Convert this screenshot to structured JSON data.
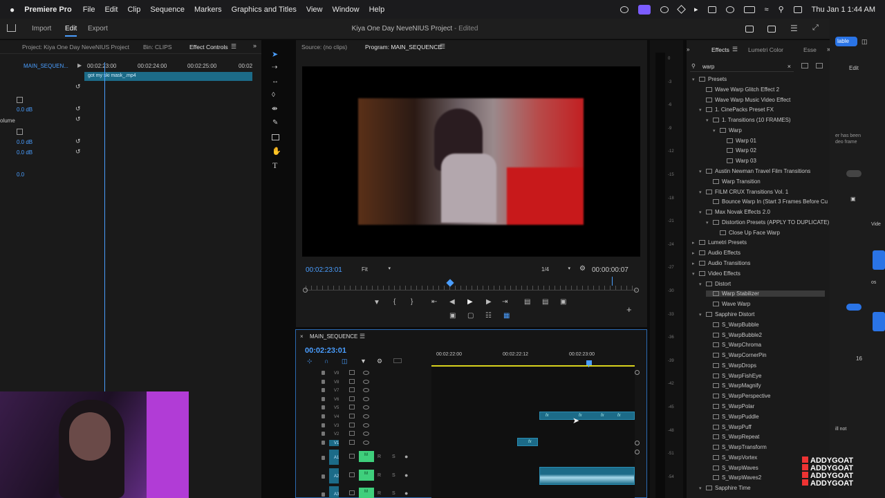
{
  "menubar": {
    "app": "Premiere Pro",
    "items": [
      "File",
      "Edit",
      "Clip",
      "Sequence",
      "Markers",
      "Graphics and Titles",
      "View",
      "Window",
      "Help"
    ],
    "clock": "Thu Jan 1  1:44 AM"
  },
  "header": {
    "import": "Import",
    "edit": "Edit",
    "export": "Export",
    "title": "Kiya One Day NeveNIUS Project",
    "status": "- Edited"
  },
  "left": {
    "tabs": [
      "Project: Kiya One Day NeveNIUS Project",
      "Bin: CLIPS",
      "Effect Controls"
    ],
    "seq_label": "MAIN_SEQUEN...",
    "timecodes": [
      "00:02:23:00",
      "00:02:24:00",
      "00:02:25:00",
      "00:02"
    ],
    "clip_name": "got my ski mask_.mp4",
    "values": [
      "0.0 dB",
      "0.0 dB",
      "0.0 dB",
      "0.0"
    ],
    "volume_label": "olume"
  },
  "source": {
    "source_tab": "Source: (no clips)",
    "program_tab": "Program: MAIN_SEQUENCE",
    "timecode": "00:02:23:01",
    "fit": "Fit",
    "ratio": "1/4",
    "duration": "00:00:00:07"
  },
  "timeline": {
    "title": "MAIN_SEQUENCE",
    "timecode": "00:02:23:01",
    "ruler": [
      "00:02:22:00",
      "00:02:22:12",
      "00:02:23:00"
    ],
    "video_tracks": [
      "V9",
      "V8",
      "V7",
      "V6",
      "V5",
      "V4",
      "V3",
      "V2",
      "V1"
    ],
    "audio_tracks": [
      "A1",
      "A2",
      "A3"
    ],
    "audio_buttons": {
      "m": "M",
      "r": "R",
      "s": "S"
    },
    "fx": "fx"
  },
  "meter": {
    "labels": [
      "0",
      "-3",
      "-6",
      "-9",
      "-12",
      "-15",
      "-18",
      "-21",
      "-24",
      "-27",
      "-30",
      "-33",
      "-36",
      "-39",
      "-42",
      "-45",
      "-48",
      "-51",
      "-54"
    ]
  },
  "effects": {
    "tabs": [
      "Effects",
      "Lumetri Color",
      "Esse"
    ],
    "search": "warp",
    "tree": [
      {
        "label": "Presets",
        "indent": 0,
        "type": "folder",
        "open": true
      },
      {
        "label": "Wave Warp Glitch Effect 2",
        "indent": 1,
        "type": "preset"
      },
      {
        "label": "Wave Warp Music Video Effect",
        "indent": 1,
        "type": "preset"
      },
      {
        "label": "1. CinePacks Preset FX",
        "indent": 1,
        "type": "folder",
        "open": true
      },
      {
        "label": "1. Transitions (10 FRAMES)",
        "indent": 2,
        "type": "folder",
        "open": true
      },
      {
        "label": "Warp",
        "indent": 3,
        "type": "folder",
        "open": true
      },
      {
        "label": "Warp 01",
        "indent": 4,
        "type": "preset"
      },
      {
        "label": "Warp 02",
        "indent": 4,
        "type": "preset"
      },
      {
        "label": "Warp 03",
        "indent": 4,
        "type": "preset"
      },
      {
        "label": "Austin Newman Travel Film Transitions",
        "indent": 1,
        "type": "folder",
        "open": true
      },
      {
        "label": "Warp Transition",
        "indent": 2,
        "type": "preset"
      },
      {
        "label": "FILM CRUX Transitions Vol. 1",
        "indent": 1,
        "type": "folder",
        "open": true
      },
      {
        "label": "Bounce Warp In (Start 3 Frames Before Cu",
        "indent": 2,
        "type": "preset"
      },
      {
        "label": "Max Novak Effects 2.0",
        "indent": 1,
        "type": "folder",
        "open": true
      },
      {
        "label": "Distortion Presets (APPLY TO DUPLICATE)",
        "indent": 2,
        "type": "folder",
        "open": true
      },
      {
        "label": "Close Up Face Warp",
        "indent": 3,
        "type": "preset"
      },
      {
        "label": "Lumetri Presets",
        "indent": 0,
        "type": "folder",
        "open": false
      },
      {
        "label": "Audio Effects",
        "indent": 0,
        "type": "folder",
        "open": false
      },
      {
        "label": "Audio Transitions",
        "indent": 0,
        "type": "folder",
        "open": false
      },
      {
        "label": "Video Effects",
        "indent": 0,
        "type": "folder",
        "open": true
      },
      {
        "label": "Distort",
        "indent": 1,
        "type": "folder",
        "open": true
      },
      {
        "label": "Warp Stabilizer",
        "indent": 2,
        "type": "effect",
        "selected": true
      },
      {
        "label": "Wave Warp",
        "indent": 2,
        "type": "effect"
      },
      {
        "label": "Sapphire Distort",
        "indent": 1,
        "type": "folder",
        "open": true
      },
      {
        "label": "S_WarpBubble",
        "indent": 2,
        "type": "effect"
      },
      {
        "label": "S_WarpBubble2",
        "indent": 2,
        "type": "effect"
      },
      {
        "label": "S_WarpChroma",
        "indent": 2,
        "type": "effect"
      },
      {
        "label": "S_WarpCornerPin",
        "indent": 2,
        "type": "effect"
      },
      {
        "label": "S_WarpDrops",
        "indent": 2,
        "type": "effect"
      },
      {
        "label": "S_WarpFishEye",
        "indent": 2,
        "type": "effect"
      },
      {
        "label": "S_WarpMagnify",
        "indent": 2,
        "type": "effect"
      },
      {
        "label": "S_WarpPerspective",
        "indent": 2,
        "type": "effect"
      },
      {
        "label": "S_WarpPolar",
        "indent": 2,
        "type": "effect"
      },
      {
        "label": "S_WarpPuddle",
        "indent": 2,
        "type": "effect"
      },
      {
        "label": "S_WarpPuff",
        "indent": 2,
        "type": "effect"
      },
      {
        "label": "S_WarpRepeat",
        "indent": 2,
        "type": "effect"
      },
      {
        "label": "S_WarpTransform",
        "indent": 2,
        "type": "effect"
      },
      {
        "label": "S_WarpVortex",
        "indent": 2,
        "type": "effect"
      },
      {
        "label": "S_WarpWaves",
        "indent": 2,
        "type": "effect"
      },
      {
        "label": "S_WarpWaves2",
        "indent": 2,
        "type": "effect"
      },
      {
        "label": "Sapphire Time",
        "indent": 1,
        "type": "folder",
        "open": true
      }
    ]
  },
  "right_edge": {
    "button": "lable",
    "edit": "Edit",
    "note": [
      "er has been",
      "deo frame"
    ],
    "num": "16",
    "vide": "Vide",
    "cos": "os",
    "illnot": "ill not"
  },
  "watermark": [
    "ADDYGOAT",
    "ADDYGOAT",
    "ADDYGOAT",
    "ADDYGOAT"
  ]
}
